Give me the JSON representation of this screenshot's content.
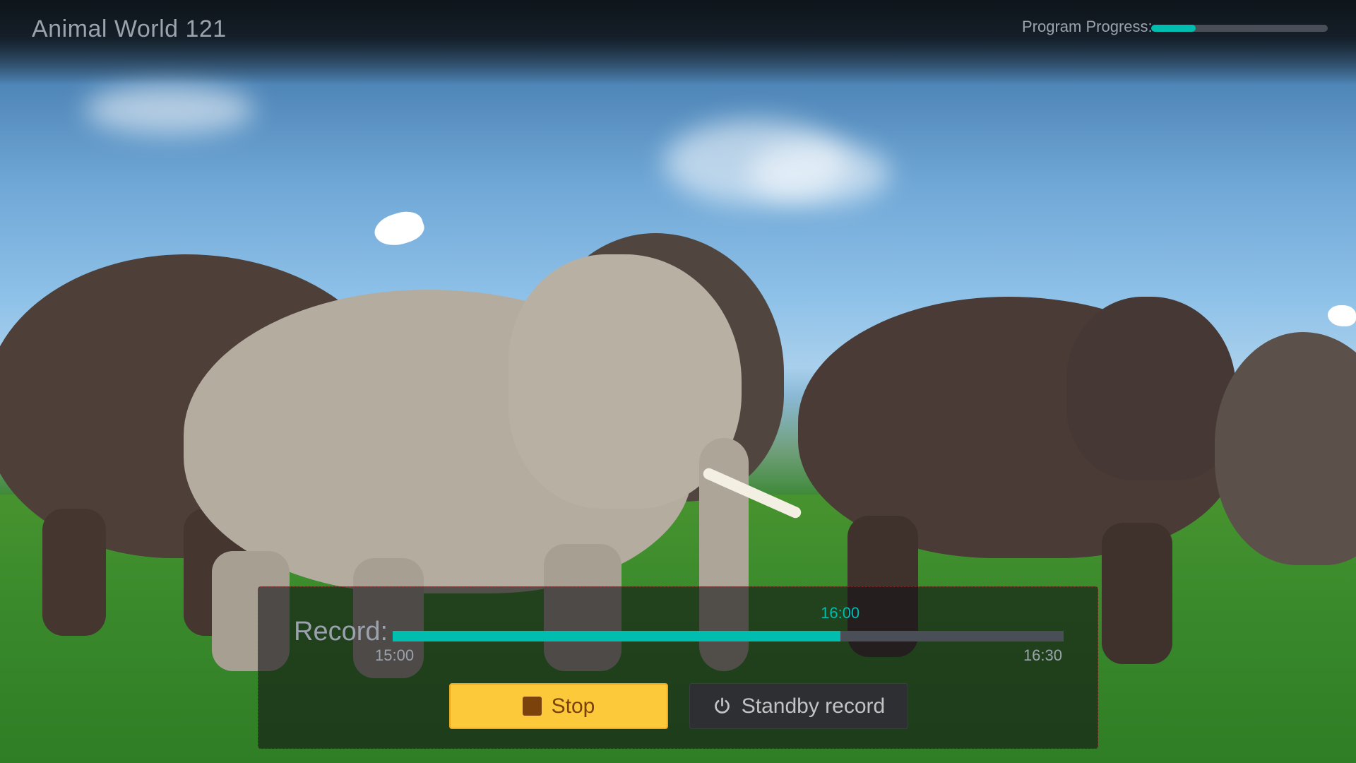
{
  "header": {
    "channel_title": "Animal World 121",
    "progress_label": "Program Progress:",
    "program_progress": 0.25
  },
  "record": {
    "label": "Record:",
    "start_time": "15:00",
    "current_time": "16:00",
    "end_time": "16:30",
    "progress": 0.667
  },
  "buttons": {
    "stop_label": "Stop",
    "standby_label": "Standby record"
  },
  "colors": {
    "accent": "#00bdb0",
    "text_muted": "#9ba2ad",
    "stop_button_bg": "#fcc93a",
    "stop_button_text": "#7b420b",
    "standby_button_bg": "#2d2f33",
    "standby_button_text": "#c2c3c4",
    "track": "#4a4f57"
  },
  "icons": {
    "stop": "stop-square-icon",
    "standby": "power-icon"
  }
}
